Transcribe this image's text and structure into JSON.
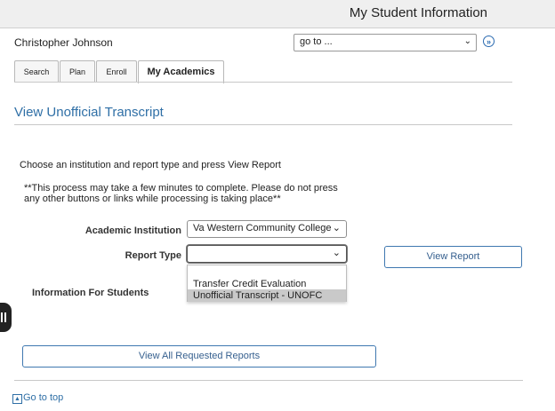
{
  "header": {
    "title": "My Student Information"
  },
  "user": {
    "name": "Christopher Johnson"
  },
  "goto": {
    "value": "go to ...",
    "go_icon": "double-chevron-right-icon"
  },
  "tabs": [
    {
      "label": "Search"
    },
    {
      "label": "Plan"
    },
    {
      "label": "Enroll"
    },
    {
      "label": "My Academics",
      "active": true
    }
  ],
  "page": {
    "title": "View Unofficial Transcript",
    "instruction": "Choose an institution and report type and press View Report",
    "note": "**This process may take a few minutes to complete. Please do not press any other buttons or links while processing is taking place**"
  },
  "form": {
    "institution_label": "Academic Institution",
    "institution_value": "Va Western Community College",
    "report_type_label": "Report Type",
    "report_type_value": "",
    "report_type_options": [
      "",
      "Transfer Credit Evaluation",
      "Unofficial Transcript - UNOFC"
    ],
    "highlighted_option": "Unofficial Transcript - UNOFC",
    "view_report_label": "View Report"
  },
  "info_label": "Information For Students",
  "view_all_label": "View All Requested Reports",
  "footer": {
    "go_to_top": "Go to top"
  },
  "colors": {
    "accent": "#2f6fa6",
    "topbar": "#efefef"
  }
}
